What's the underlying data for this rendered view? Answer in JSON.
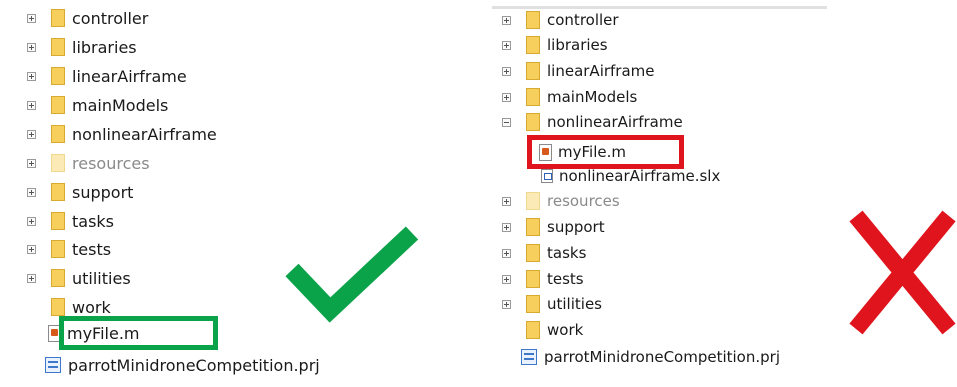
{
  "left_tree": {
    "items": [
      {
        "label": "controller"
      },
      {
        "label": "libraries"
      },
      {
        "label": "linearAirframe"
      },
      {
        "label": "mainModels"
      },
      {
        "label": "nonlinearAirframe"
      },
      {
        "label": "resources"
      },
      {
        "label": "support"
      },
      {
        "label": "tasks"
      },
      {
        "label": "tests"
      },
      {
        "label": "utilities"
      },
      {
        "label": "work"
      },
      {
        "label": "myFile.m"
      },
      {
        "label": "parrotMinidroneCompetition.prj"
      }
    ]
  },
  "right_tree": {
    "items": [
      {
        "label": "controller"
      },
      {
        "label": "libraries"
      },
      {
        "label": "linearAirframe"
      },
      {
        "label": "mainModels"
      },
      {
        "label": "nonlinearAirframe"
      },
      {
        "label": "myFile.m"
      },
      {
        "label": "nonlinearAirframe.slx"
      },
      {
        "label": "resources"
      },
      {
        "label": "support"
      },
      {
        "label": "tasks"
      },
      {
        "label": "tests"
      },
      {
        "label": "utilities"
      },
      {
        "label": "work"
      },
      {
        "label": "parrotMinidroneCompetition.prj"
      }
    ]
  },
  "colors": {
    "correct_accent": "#0aa34a",
    "wrong_accent": "#e0141c",
    "folder": "#f6cf5c"
  },
  "icons": {
    "correct": "check-mark-icon",
    "wrong": "x-mark-icon"
  }
}
